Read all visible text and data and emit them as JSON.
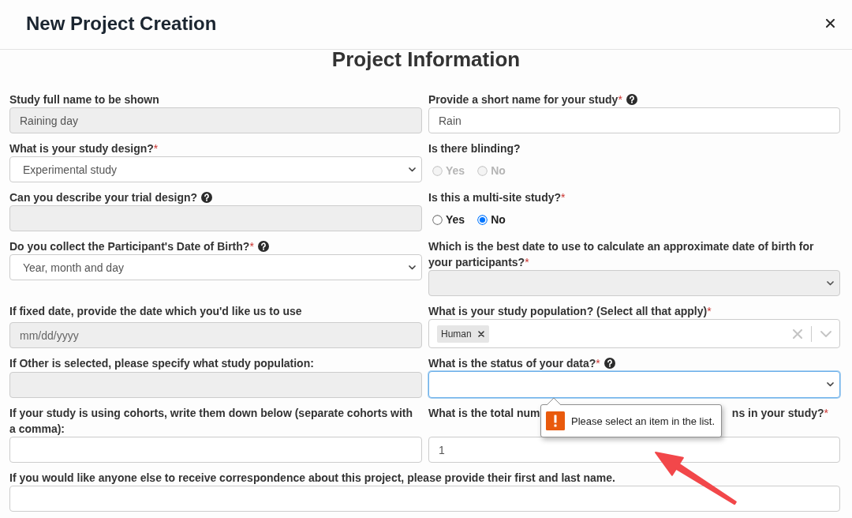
{
  "dialog": {
    "title": "New Project Creation"
  },
  "form": {
    "title": "Project Information",
    "rows": [
      {
        "fields": [
          {
            "kind": "text",
            "label": "Study full name to be shown",
            "help": false,
            "disabled": true,
            "focused": false,
            "value": "Raining day"
          },
          {
            "kind": "text",
            "label": "Provide a short name for your study",
            "required_mark": "*",
            "help": true,
            "disabled": false,
            "focused": false,
            "value": "Rain"
          }
        ]
      },
      {
        "fields": [
          {
            "kind": "select",
            "label": "What is your study design?",
            "required_mark": "*",
            "help": false,
            "disabled": false,
            "focused": false,
            "value": "Experimental study"
          },
          {
            "kind": "radio",
            "label": "Is there blinding?",
            "help": false,
            "disabled": true,
            "focused": false,
            "options": [
              {
                "label": "Yes",
                "selected": false
              },
              {
                "label": "No",
                "selected": false
              }
            ]
          }
        ]
      },
      {
        "fields": [
          {
            "kind": "text",
            "label": "Can you describe your trial design?",
            "help": true,
            "disabled": true,
            "focused": false
          },
          {
            "kind": "radio",
            "label": "Is this a multi-site study?",
            "required_mark": "*",
            "help": false,
            "disabled": false,
            "focused": false,
            "options": [
              {
                "label": "Yes",
                "selected": false
              },
              {
                "label": "No",
                "selected": true
              }
            ]
          }
        ]
      },
      {
        "fields": [
          {
            "kind": "select",
            "label": "Do you collect the Participant's Date of Birth?",
            "required_mark": "*",
            "help": true,
            "disabled": false,
            "focused": false,
            "value": "Year, month and day"
          },
          {
            "kind": "select",
            "label": "Which is the best date to use to calculate an approximate date of birth for your participants?",
            "required_mark": "*",
            "help": false,
            "disabled": true,
            "focused": false
          }
        ]
      },
      {
        "fields": [
          {
            "kind": "text",
            "label": "If fixed date, provide the date which you'd like us to use",
            "help": false,
            "disabled": true,
            "focused": false,
            "placeholder": "mm/dd/yyyy"
          },
          {
            "kind": "multiselect",
            "label": "What is your study population? (Select all that apply)",
            "required_mark": "*",
            "help": false,
            "disabled": false,
            "focused": false,
            "tags": [
              "Human"
            ]
          }
        ]
      },
      {
        "fields": [
          {
            "kind": "text",
            "label": "If Other is selected, please specify what study population:",
            "help": false,
            "disabled": true,
            "focused": false
          },
          {
            "kind": "select",
            "label": "What is the status of your data?",
            "required_mark": "*",
            "help": true,
            "disabled": false,
            "focused": true,
            "validation_message": "Please select an item in the list."
          }
        ]
      },
      {
        "fields": [
          {
            "kind": "text",
            "label": "If your study is using cohorts, write them down below (separate cohorts with a comma):",
            "help": false,
            "disabled": false,
            "focused": false
          },
          {
            "kind": "text",
            "label_parts": [
              "What is the total num",
              "ns in your study?"
            ],
            "required_mark": "*",
            "help": false,
            "disabled": false,
            "focused": false,
            "value": "1"
          }
        ]
      },
      {
        "fields": [
          {
            "kind": "text",
            "label": "If you would like anyone else to receive correspondence about this project, please provide their first and last name.",
            "help": false,
            "disabled": false,
            "focused": false
          }
        ]
      }
    ]
  }
}
